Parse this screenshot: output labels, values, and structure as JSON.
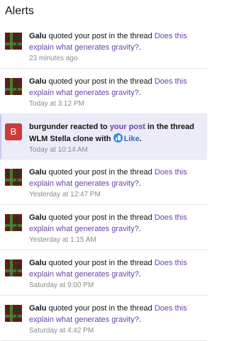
{
  "header": {
    "title": "Alerts"
  },
  "alerts": [
    {
      "user": "Galu",
      "action": " quoted your post in the thread ",
      "thread": "Does this explain what generates gravity?",
      "end": ".",
      "time": "23 minutes ago"
    },
    {
      "user": "Galu",
      "action": " quoted your post in the thread ",
      "thread": "Does this explain what generates gravity?",
      "end": ".",
      "time": "Today at 3:12 PM"
    },
    {
      "user": "burgunder",
      "avatar_letter": "B",
      "action1": " reacted to ",
      "post_link": "your post",
      "action2": " in the thread ",
      "thread": "WLM Stella clone",
      "with": " with ",
      "reaction": "Like",
      "end": ".",
      "time": "Today at 10:14 AM"
    },
    {
      "user": "Galu",
      "action": " quoted your post in the thread ",
      "thread": "Does this explain what generates gravity?",
      "end": ".",
      "time": "Yesterday at 12:47 PM"
    },
    {
      "user": "Galu",
      "action": " quoted your post in the thread ",
      "thread": "Does this explain what generates gravity?",
      "end": ".",
      "time": "Yesterday at 1:15 AM"
    },
    {
      "user": "Galu",
      "action": " quoted your post in the thread ",
      "thread": "Does this explain what generates gravity?",
      "end": ".",
      "time": "Saturday at 9:00 PM"
    },
    {
      "user": "Galu",
      "action": " quoted your post in the thread ",
      "thread": "Does this explain what generates gravity?",
      "end": ".",
      "time": "Saturday at 4:42 PM"
    }
  ],
  "colors": {
    "link": "#6a42a8",
    "unread_bg": "#ebecf8",
    "avatar_letter_bg": "#cc3a3a",
    "like_icon": "#2f8fe8"
  },
  "icons": {
    "galu_avatar": "tartan-avatar",
    "reaction": "like-icon"
  }
}
